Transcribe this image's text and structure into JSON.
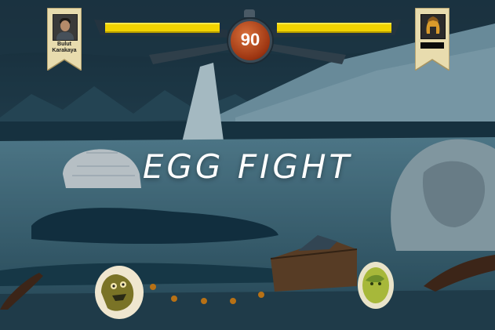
{
  "game": {
    "title": "EGG FIGHT",
    "timer": "90"
  },
  "player": {
    "name": "Bulut Karakaya",
    "health": 1.0,
    "bar_color": "#f2d300"
  },
  "opponent": {
    "name": "",
    "health": 1.0,
    "avatar_icon": "spartan-helmet-icon"
  },
  "colors": {
    "health": "#f2d300",
    "timer_face": "#b3461a",
    "banner": "#e8dcae",
    "title": "#ffffff"
  },
  "eggs": {
    "player_egg": "monster-egg-icon",
    "opponent_egg": "green-monster-egg-icon"
  }
}
